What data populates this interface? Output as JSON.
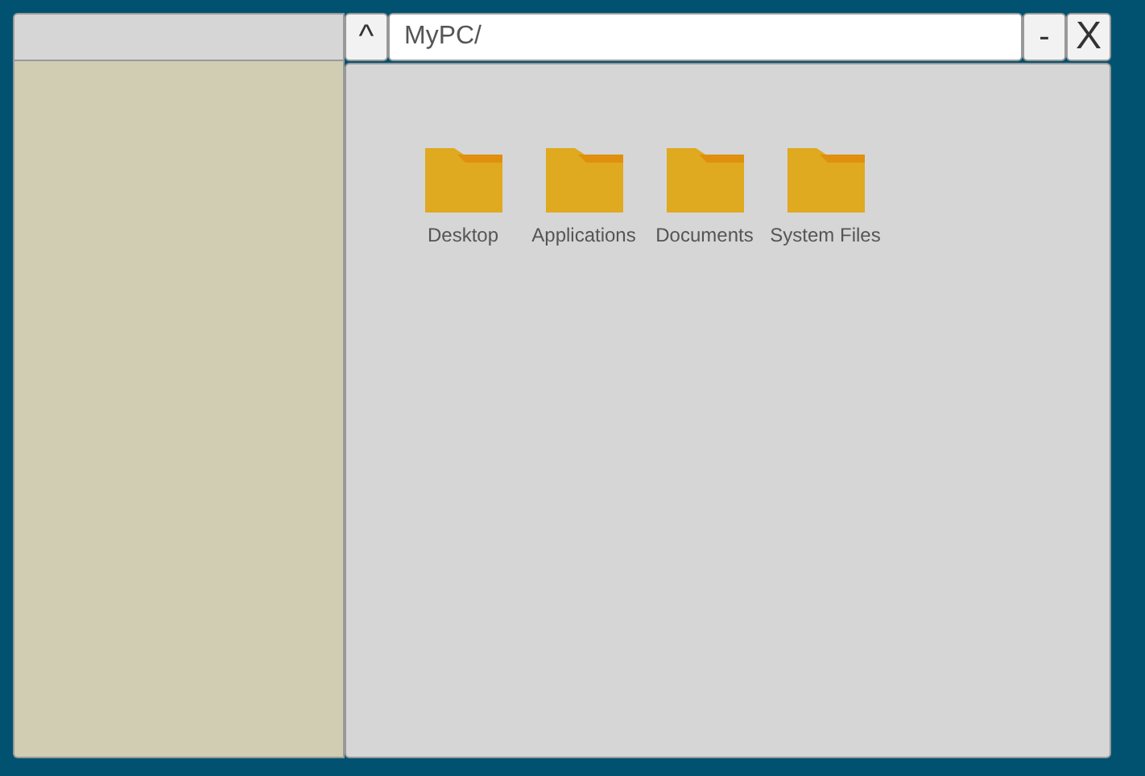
{
  "toolbar": {
    "up_button": "^",
    "address": "MyPC/",
    "minimize_button": "-",
    "close_button": "X"
  },
  "items": [
    {
      "kind": "folder",
      "label": "Desktop"
    },
    {
      "kind": "folder",
      "label": "Applications"
    },
    {
      "kind": "folder",
      "label": "Documents"
    },
    {
      "kind": "folder",
      "label": "System Files"
    }
  ]
}
